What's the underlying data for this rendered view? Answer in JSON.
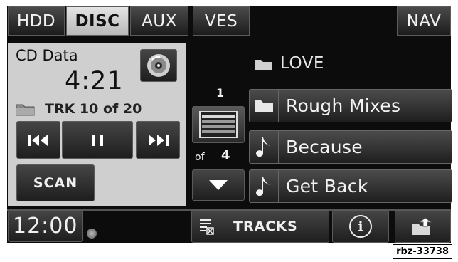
{
  "tabs": [
    {
      "label": "HDD",
      "active": false
    },
    {
      "label": "DISC",
      "active": true
    },
    {
      "label": "AUX",
      "active": false
    },
    {
      "label": "VES",
      "active": false
    }
  ],
  "nav_label": "NAV",
  "player": {
    "source": "CD Data",
    "elapsed": "4:21",
    "track_info": "TRK 10 of 20",
    "scan_label": "SCAN",
    "icons": [
      "disc-icon",
      "folder-icon",
      "previous-track-icon",
      "pause-icon",
      "next-track-icon"
    ]
  },
  "browser": {
    "current_folder": "LOVE",
    "page": "1",
    "of_label": "of",
    "total_pages": "4",
    "items": [
      {
        "label": "Rough Mixes",
        "type": "folder"
      },
      {
        "label": "Because",
        "type": "song"
      },
      {
        "label": "Get Back",
        "type": "song"
      }
    ]
  },
  "bottom": {
    "clock": "12:00",
    "tracks_label": "TRACKS",
    "info_icon": "i"
  },
  "reference_tag": "rbz-33738",
  "colors": {
    "panel": "#cfcfcf",
    "active_tab": "#d0d0d0",
    "background": "#0c0c0c"
  }
}
